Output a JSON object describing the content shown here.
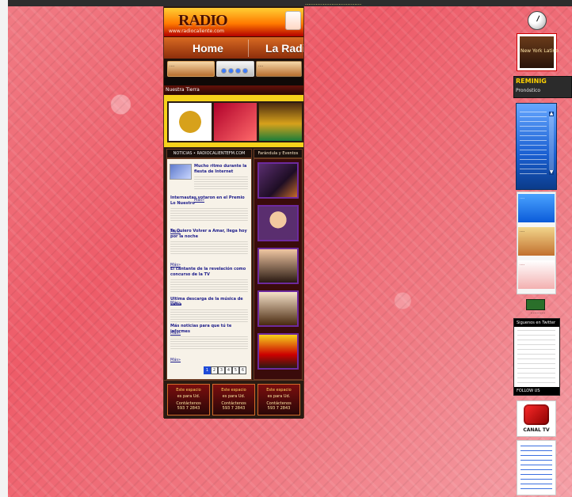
{
  "header": {
    "site_title": "RADIO",
    "site_url": "www.radiocaliente.com",
    "top_marquee": "................................"
  },
  "nav": {
    "items": [
      {
        "label": "Home"
      },
      {
        "label": "La Radio"
      }
    ]
  },
  "strip": {
    "left": "....",
    "middle": "....",
    "right": "...."
  },
  "sections": {
    "gallery_title": "Nuestra Tierra"
  },
  "gallery": {
    "items": [
      {
        "caption": "...."
      },
      {
        "caption": "...."
      },
      {
        "caption": "...."
      }
    ]
  },
  "news": {
    "header": "NOTICIAS • RADIOCALIENTEFM.COM",
    "items": [
      {
        "title": "Mucho ritmo durante la fiesta de Internet"
      },
      {
        "title": "Internautas votaron en el Premio Lo Nuestro"
      },
      {
        "title": "Te Quiero Volver a Amar, llega hoy por la noche"
      },
      {
        "title": "El cantante de la revelación como concurso de la TV"
      },
      {
        "title": "Ultima descarga de la música de salsa"
      },
      {
        "title": "Más noticias para que tú te informes"
      }
    ],
    "read_more": "Más»",
    "pages": [
      "1",
      "2",
      "3",
      "4",
      "5",
      "6"
    ]
  },
  "right_panel": {
    "header": "Farándula y Eventos"
  },
  "ads": {
    "items": [
      {
        "line1": "Este espacio",
        "line2": "es para Ud.",
        "line3": "Contáctenos",
        "line4": "593 7 2843"
      },
      {
        "line1": "Este espacio",
        "line2": "es para Ud.",
        "line3": "Contáctenos",
        "line4": "593 7 2843"
      },
      {
        "line1": "Este espacio",
        "line2": "es para Ud.",
        "line3": "Contáctenos",
        "line4": "593 7 2843"
      }
    ]
  },
  "sidebar": {
    "weather_title": "REMINIG",
    "weather_sub": "Pronóstico",
    "nyl_text": "New York Latino",
    "small_caption": "............",
    "social_head": "Siguenos en Twitter",
    "social_foot": "FOLLOW US",
    "canal_text": "CANAL TV"
  }
}
